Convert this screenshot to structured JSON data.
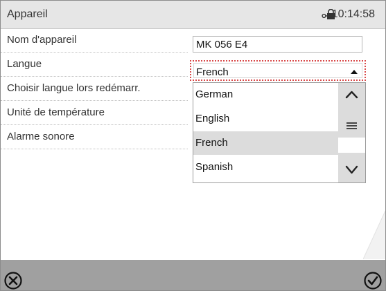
{
  "header": {
    "title": "Appareil",
    "time": "10:14:58"
  },
  "rows": [
    {
      "label": "Nom d'appareil"
    },
    {
      "label": "Langue"
    },
    {
      "label": "Choisir langue lors redémarr."
    },
    {
      "label": "Unité de température"
    },
    {
      "label": "Alarme sonore"
    }
  ],
  "device_name": {
    "value": "MK 056 E4"
  },
  "language_select": {
    "value": "French",
    "options": [
      "German",
      "English",
      "French",
      "Spanish"
    ],
    "selected": "French"
  },
  "icons": {
    "status": "lock-key-icon",
    "cancel": "cancel-circle-x-icon",
    "confirm": "confirm-circle-check-icon",
    "scroll_up": "chevron-up-icon",
    "scroll_thumb": "hamburger-icon",
    "scroll_down": "chevron-down-icon",
    "select_arrow": "triangle-up-icon"
  },
  "colors": {
    "header_bg": "#e6e6e6",
    "footer_bg": "#a0a0a0",
    "focus_outline": "#d94a4a",
    "selected_option_bg": "#dcdcdc"
  }
}
